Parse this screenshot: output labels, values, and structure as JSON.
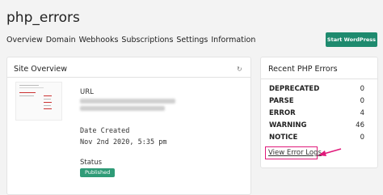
{
  "header": {
    "title": "php_errors",
    "tabs": [
      "Overview",
      "Domain",
      "Webhooks",
      "Subscriptions",
      "Settings",
      "Information"
    ],
    "start_button": "Start WordPress",
    "accent": "#1e8a6e"
  },
  "site_overview": {
    "title": "Site Overview",
    "refresh_icon": "refresh-icon",
    "url_label": "URL",
    "date_label": "Date Created",
    "date_value": "Nov 2nd 2020, 5:35 pm",
    "status_label": "Status",
    "status_value": "Published",
    "status_color": "#2f9b77"
  },
  "recent_errors": {
    "title": "Recent PHP Errors",
    "rows": [
      {
        "type": "DEPRECATED",
        "count": "0"
      },
      {
        "type": "PARSE",
        "count": "0"
      },
      {
        "type": "ERROR",
        "count": "4"
      },
      {
        "type": "WARNING",
        "count": "46"
      },
      {
        "type": "NOTICE",
        "count": "0"
      }
    ],
    "view_logs": "View Error Logs",
    "highlight_color": "#e0197a"
  }
}
